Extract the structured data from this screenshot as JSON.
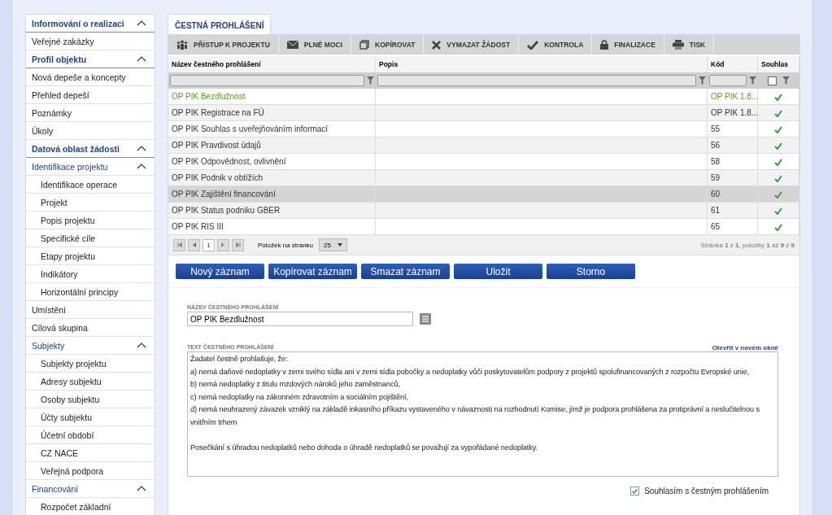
{
  "sidebar": {
    "sections": [
      {
        "label": "Informování o realizaci",
        "expanded": true,
        "children": [
          {
            "label": "Veřejné zakázky"
          }
        ]
      },
      {
        "label": "Profil objektu",
        "expanded": true,
        "children": [
          {
            "label": "Nová depeše a koncepty"
          },
          {
            "label": "Přehled depeší"
          },
          {
            "label": "Poznámky"
          },
          {
            "label": "Úkoly"
          }
        ]
      },
      {
        "label": "Datová oblast žádosti",
        "expanded": true,
        "children": [
          {
            "label": "Identifikace projektu",
            "expanded": true,
            "children": [
              {
                "label": "Identifikace operace"
              },
              {
                "label": "Projekt"
              },
              {
                "label": "Popis projektu"
              },
              {
                "label": "Specifické cíle"
              },
              {
                "label": "Etapy projektu"
              },
              {
                "label": "Indikátory"
              },
              {
                "label": "Horizontální principy"
              }
            ]
          },
          {
            "label": "Umístění"
          },
          {
            "label": "Cílová skupina"
          },
          {
            "label": "Subjekty",
            "expanded": true,
            "children": [
              {
                "label": "Subjekty projektu"
              },
              {
                "label": "Adresy subjektu"
              },
              {
                "label": "Osoby subjektu"
              },
              {
                "label": "Účty subjektu"
              },
              {
                "label": "Účetní období"
              },
              {
                "label": "CZ NACE"
              },
              {
                "label": "Veřejná podpora"
              }
            ]
          },
          {
            "label": "Financování",
            "expanded": true,
            "children": [
              {
                "label": "Rozpočet základní"
              }
            ]
          }
        ]
      }
    ]
  },
  "tab": {
    "label": "ČESTNÁ PROHLÁŠENÍ",
    "selected": true
  },
  "toolbar": [
    {
      "kind": "people",
      "label": "PŘÍSTUP K PROJEKTU"
    },
    {
      "kind": "mail",
      "label": "PLNÉ MOCI"
    },
    {
      "kind": "copy",
      "label": "KOPÍROVAT"
    },
    {
      "kind": "delete",
      "label": "VYMAZAT ŽÁDOST"
    },
    {
      "kind": "check",
      "label": "KONTROLA"
    },
    {
      "kind": "lock",
      "label": "FINALIZACE"
    },
    {
      "kind": "print",
      "label": "TISK"
    }
  ],
  "table": {
    "columns": [
      "Název čestného prohlášení",
      "Popis",
      "Kód",
      "Souhlas"
    ],
    "filter_checkbox": {
      "checked": false
    },
    "rows": [
      {
        "name": "OP PIK Bezdlužnost",
        "code": "OP PIK 1.8...",
        "agreed": true,
        "selected": true,
        "hovered": false
      },
      {
        "name": "OP PIK Registrace na FÚ",
        "code": "OP PIK 1.8...",
        "agreed": true,
        "selected": false,
        "hovered": false
      },
      {
        "name": "OP PIK Souhlas s uveřejňováním informací",
        "code": "55",
        "agreed": true,
        "selected": false,
        "hovered": false
      },
      {
        "name": "OP PIK Pravdivost údajů",
        "code": "56",
        "agreed": true,
        "selected": false,
        "hovered": false
      },
      {
        "name": "OP PIK Odpovědnost, ovlivnění",
        "code": "58",
        "agreed": true,
        "selected": false,
        "hovered": false
      },
      {
        "name": "OP PIK Podnik v obtížích",
        "code": "59",
        "agreed": true,
        "selected": false,
        "hovered": false
      },
      {
        "name": "OP PIK Zajištění financování",
        "code": "60",
        "agreed": true,
        "selected": false,
        "hovered": true
      },
      {
        "name": "OP PIK Status podniku GBER",
        "code": "61",
        "agreed": true,
        "selected": false,
        "hovered": false
      },
      {
        "name": "OP PIK RIS III",
        "code": "65",
        "agreed": true,
        "selected": false,
        "hovered": false
      }
    ]
  },
  "pager": {
    "page": "1",
    "per_page_label": "Položek na stránku",
    "per_page": "25",
    "summary": "Stránka **1** z **1**, položky **1** až **9** z **9**"
  },
  "actions": [
    "Nový záznam",
    "Kopírovat záznam",
    "Smazat záznam",
    "Uložit",
    "Storno"
  ],
  "form": {
    "name_label": "NÁZEV ČESTNÉHO PROHLÁŠENÍ",
    "name_value": "OP PIK Bezdlužnost",
    "text_label": "TEXT ČESTNÉHO PROHLÁŠENÍ",
    "open_link": "Otevřít v novém okně",
    "text": "Žadatel čestně prohlašuje, že:\na) nemá daňové nedoplatky v zemi svého sídla ani v zemi sídla pobočky a nedoplatky vůči poskytovatelům podpory z projektů spolufinancovaných z rozpočtu Evropské unie,\nb) nemá nedoplatky z titulu mzdových nároků jeho zaměstnanců,\nc) nemá nedoplatky na zákonném zdravotním a sociálním pojištění,\nd) nemá neuhrazený závazek vzniklý na základě inkasního příkazu vystaveného v návaznosti na rozhodnutí Komise, jímž je podpora prohlášena za protiprávní a neslučitelnou s vnitřním trhem\n\nPosečkání s úhradou nedoplatků nebo dohoda o úhradě nedoplatků se považují za vypořádané nedoplatky.",
    "agree": {
      "label": "Souhlasím s čestným prohlášením",
      "checked": true
    }
  }
}
